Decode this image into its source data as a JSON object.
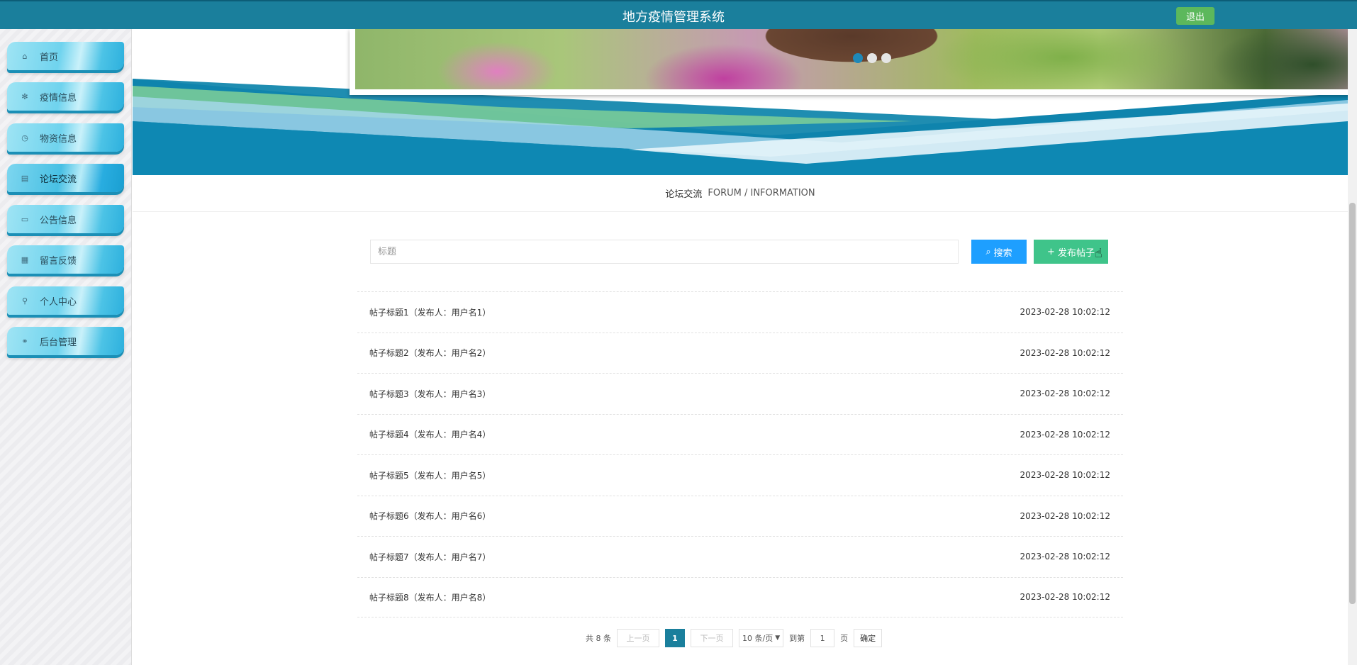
{
  "header": {
    "title": "地方疫情管理系统",
    "logout_label": "退出"
  },
  "sidebar": {
    "items": [
      {
        "label": "首页",
        "icon": "home-icon",
        "glyph": "⌂"
      },
      {
        "label": "疫情信息",
        "icon": "virus-icon",
        "glyph": "✻"
      },
      {
        "label": "物资信息",
        "icon": "clock-icon",
        "glyph": "◷"
      },
      {
        "label": "论坛交流",
        "icon": "forum-icon",
        "glyph": "▤"
      },
      {
        "label": "公告信息",
        "icon": "book-icon",
        "glyph": "▭"
      },
      {
        "label": "留言反馈",
        "icon": "trash-icon",
        "glyph": "▦"
      },
      {
        "label": "个人中心",
        "icon": "user-icon",
        "glyph": "⚲"
      },
      {
        "label": "后台管理",
        "icon": "link-icon",
        "glyph": "⚭"
      }
    ],
    "active_index": 3
  },
  "section": {
    "title_cn": "论坛交流",
    "title_en": "FORUM / INFORMATION"
  },
  "search": {
    "placeholder": "标题",
    "value": "",
    "search_label": "搜索",
    "post_label": "发布帖子"
  },
  "posts": [
    {
      "title": "帖子标题1（发布人：用户名1）",
      "time": "2023-02-28 10:02:12"
    },
    {
      "title": "帖子标题2（发布人：用户名2）",
      "time": "2023-02-28 10:02:12"
    },
    {
      "title": "帖子标题3（发布人：用户名3）",
      "time": "2023-02-28 10:02:12"
    },
    {
      "title": "帖子标题4（发布人：用户名4）",
      "time": "2023-02-28 10:02:12"
    },
    {
      "title": "帖子标题5（发布人：用户名5）",
      "time": "2023-02-28 10:02:12"
    },
    {
      "title": "帖子标题6（发布人：用户名6）",
      "time": "2023-02-28 10:02:12"
    },
    {
      "title": "帖子标题7（发布人：用户名7）",
      "time": "2023-02-28 10:02:12"
    },
    {
      "title": "帖子标题8（发布人：用户名8）",
      "time": "2023-02-28 10:02:12"
    }
  ],
  "pagination": {
    "total_label": "共 8 条",
    "prev_label": "上一页",
    "current_page": "1",
    "next_label": "下一页",
    "page_size_label": "10 条/页",
    "goto_label": "到第",
    "goto_value": "1",
    "page_unit": "页",
    "confirm_label": "确定"
  },
  "colors": {
    "header": "#1a7f9c",
    "logout": "#5cb85c",
    "search": "#1e9fff",
    "post": "#3fc48a",
    "active_dot": "#1e88b8"
  }
}
